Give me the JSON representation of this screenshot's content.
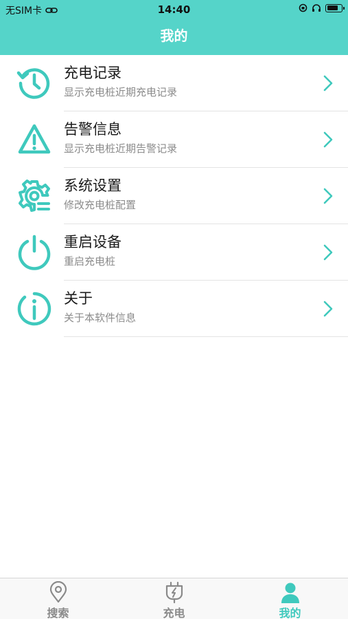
{
  "status_bar": {
    "carrier": "无SIM卡",
    "time": "14:40",
    "battery_level": 0.8
  },
  "nav": {
    "title": "我的"
  },
  "menu": [
    {
      "icon": "history-icon",
      "title": "充电记录",
      "subtitle": "显示充电桩近期充电记录"
    },
    {
      "icon": "warning-icon",
      "title": "告警信息",
      "subtitle": "显示充电桩近期告警记录"
    },
    {
      "icon": "settings-gear-icon",
      "title": "系统设置",
      "subtitle": "修改充电桩配置"
    },
    {
      "icon": "power-icon",
      "title": "重启设备",
      "subtitle": "重启充电桩"
    },
    {
      "icon": "info-icon",
      "title": "关于",
      "subtitle": "关于本软件信息"
    }
  ],
  "tabbar": {
    "active_index": 2,
    "tabs": [
      {
        "icon": "location-pin-icon",
        "label": "搜索"
      },
      {
        "icon": "charging-plug-icon",
        "label": "充电"
      },
      {
        "icon": "user-icon",
        "label": "我的"
      }
    ]
  },
  "colors": {
    "accent": "#55d4c9",
    "icon_teal": "#3fc9bd",
    "inactive": "#8a8a8a"
  }
}
